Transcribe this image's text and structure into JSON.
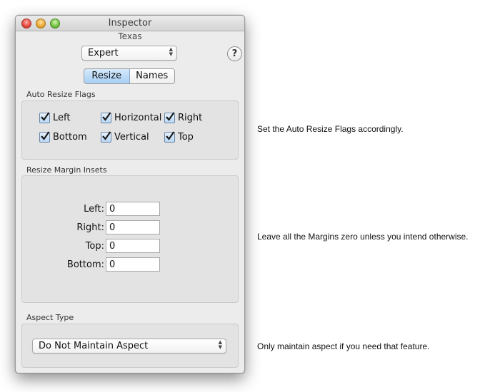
{
  "window": {
    "title": "Inspector",
    "subtitle": "Texas",
    "mode_popup": {
      "selected": "Expert"
    },
    "help_label": "?",
    "tabs": [
      {
        "label": "Resize",
        "active": true
      },
      {
        "label": "Names",
        "active": false
      }
    ],
    "auto_resize": {
      "label": "Auto Resize Flags",
      "flags": [
        {
          "label": "Left",
          "checked": true
        },
        {
          "label": "Horizontal",
          "checked": true
        },
        {
          "label": "Right",
          "checked": true
        },
        {
          "label": "Bottom",
          "checked": true
        },
        {
          "label": "Vertical",
          "checked": true
        },
        {
          "label": "Top",
          "checked": true
        }
      ]
    },
    "margins": {
      "label": "Resize Margin Insets",
      "fields": [
        {
          "label": "Left:",
          "value": "0"
        },
        {
          "label": "Right:",
          "value": "0"
        },
        {
          "label": "Top:",
          "value": "0"
        },
        {
          "label": "Bottom:",
          "value": "0"
        }
      ]
    },
    "aspect": {
      "label": "Aspect Type",
      "selected": "Do Not Maintain Aspect"
    }
  },
  "notes": {
    "flags": "Set the Auto Resize Flags accordingly.",
    "margins": "Leave all the Margins zero unless you intend otherwise.",
    "aspect": "Only maintain aspect if you need that feature."
  }
}
